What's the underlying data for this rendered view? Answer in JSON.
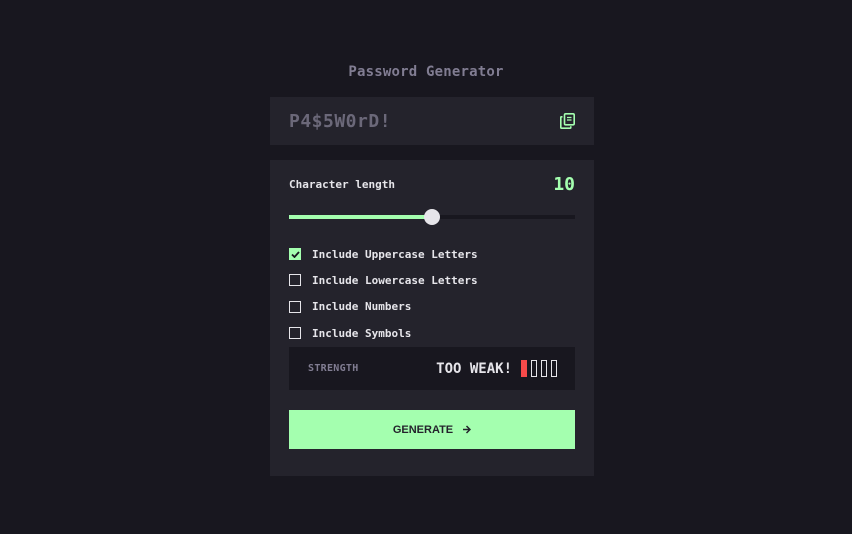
{
  "app": {
    "title": "Password Generator"
  },
  "password": {
    "value": "P4$5W0rD!",
    "copy_icon": "copy-icon"
  },
  "length": {
    "label": "Character length",
    "value": "10",
    "slider_fraction": 0.5
  },
  "options": [
    {
      "label": "Include Uppercase Letters",
      "checked": true
    },
    {
      "label": "Include Lowercase Letters",
      "checked": false
    },
    {
      "label": "Include Numbers",
      "checked": false
    },
    {
      "label": "Include Symbols",
      "checked": false
    }
  ],
  "strength": {
    "label": "STRENGTH",
    "text": "TOO WEAK!",
    "bars_filled": 1,
    "bars_total": 4,
    "color": "#f64a4a"
  },
  "generate": {
    "label": "GENERATE",
    "icon": "arrow-right-icon"
  },
  "colors": {
    "background": "#18171f",
    "panel": "#24232c",
    "accent": "#a4ffaf",
    "muted": "#817d92",
    "weak": "#f64a4a"
  }
}
